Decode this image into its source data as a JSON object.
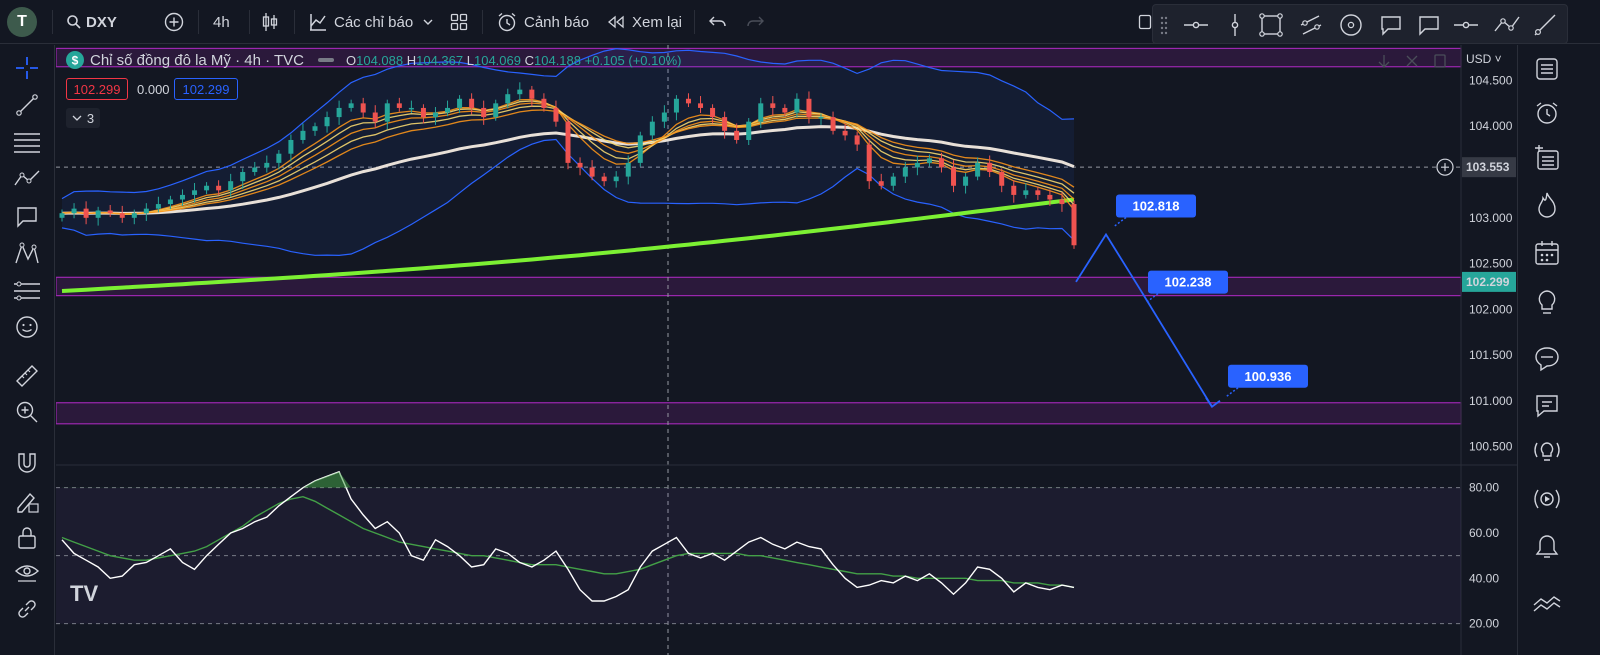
{
  "toolbar": {
    "avatar_letter": "T",
    "symbol": "DXY",
    "interval": "4h",
    "indicators_label": "Các chỉ báo",
    "alerts_label": "Cảnh báo",
    "replay_label": "Xem lại"
  },
  "legend": {
    "title": "Chỉ số đồng đô la Mỹ · 4h · TVC",
    "open_label": "O",
    "open": "104.088",
    "high_label": "H",
    "high": "104.367",
    "low_label": "L",
    "low": "104.069",
    "close_label": "C",
    "close": "104.188",
    "change": "+0.105 (+0.10%)",
    "bid": "102.299",
    "spread": "0.000",
    "ask": "102.299",
    "hidden_count": "3"
  },
  "price_axis": {
    "currency": "USD",
    "ticks": [
      "104.500",
      "104.000",
      "103.500",
      "103.000",
      "102.500",
      "102.000",
      "101.500",
      "101.000",
      "100.500"
    ],
    "crosshair_price": "103.553",
    "last_price": "102.299"
  },
  "rsi_axis": {
    "ticks": [
      "80.00",
      "60.00",
      "40.00",
      "20.00"
    ]
  },
  "annotations": [
    "102.818",
    "102.238",
    "100.936"
  ],
  "watermark": "TV",
  "colors": {
    "background": "#131722",
    "up": "#26a69a",
    "down": "#ef5350",
    "bollinger": "#2962ff",
    "ema_fast": "#f7931a",
    "ema_slow": "#f5d76e",
    "sma_white": "#e8e0d8",
    "sma_green": "#7cf033",
    "zone": "#9c27b0",
    "rsi": "#ffffff",
    "rsi_ma": "#43a047",
    "annotation": "#2962ff"
  },
  "icons": {
    "left": [
      "crosshair-icon",
      "trendline-icon",
      "fib-icon",
      "pattern-icon",
      "text-icon",
      "xabcd-icon",
      "forecast-icon",
      "emoji-icon",
      "ruler-icon",
      "zoom-icon",
      "magnet-icon",
      "lock-drawing-icon",
      "lock-icon",
      "eye-icon",
      "link-icon"
    ],
    "right": [
      "watchlist-icon",
      "alarm-icon",
      "data-window-icon",
      "hotlist-icon",
      "calendar-icon",
      "ideas-icon",
      "chat-icon",
      "messages-icon",
      "signals-icon",
      "streams-icon",
      "notifications-icon",
      "layers-icon"
    ],
    "drawing": [
      "drag-handle-icon",
      "horizontal-line-icon",
      "vertical-line-icon",
      "rectangle-icon",
      "parallel-channel-icon",
      "circle-icon",
      "callout-icon",
      "comment-icon",
      "price-line-icon",
      "path-icon",
      "ray-icon"
    ]
  },
  "chart_data": [
    {
      "type": "candlestick",
      "title": "Chỉ số đồng đô la Mỹ · 4h · TVC",
      "y_range": [
        100.3,
        104.8
      ],
      "n_bars": 85,
      "zones": [
        [
          104.65,
          104.85
        ],
        [
          102.15,
          102.35
        ],
        [
          100.75,
          100.98
        ]
      ],
      "closes": [
        103.05,
        103.1,
        103.0,
        103.08,
        103.05,
        103.0,
        103.05,
        103.1,
        103.15,
        103.2,
        103.25,
        103.3,
        103.35,
        103.3,
        103.4,
        103.5,
        103.55,
        103.6,
        103.7,
        103.85,
        103.95,
        104.0,
        104.1,
        104.2,
        104.25,
        104.15,
        104.05,
        104.25,
        104.2,
        104.2,
        104.1,
        104.15,
        104.2,
        104.3,
        104.2,
        104.1,
        104.25,
        104.35,
        104.4,
        104.3,
        104.2,
        104.05,
        103.6,
        103.55,
        103.45,
        103.4,
        103.45,
        103.6,
        103.9,
        104.05,
        104.15,
        104.3,
        104.25,
        104.2,
        104.1,
        103.95,
        103.85,
        104.05,
        104.25,
        104.2,
        104.15,
        104.3,
        104.1,
        104.1,
        103.95,
        103.9,
        103.8,
        103.4,
        103.35,
        103.45,
        103.55,
        103.6,
        103.65,
        103.55,
        103.35,
        103.45,
        103.6,
        103.5,
        103.35,
        103.25,
        103.3,
        103.25,
        103.2,
        103.15,
        102.7
      ],
      "bollinger": {
        "upper_start": 103.4,
        "lower_start": 102.5
      },
      "series": [
        {
          "name": "",
          "kind": "ema_ribbon"
        },
        {
          "name": "",
          "kind": "sma_white"
        },
        {
          "name": "",
          "kind": "sma_green",
          "values": [
            102.2,
            103.2
          ]
        }
      ],
      "projection": [
        [
          102.3,
          102.818
        ],
        [
          102.238,
          100.936
        ]
      ]
    },
    {
      "type": "line",
      "y_range": [
        15,
        90
      ],
      "levels": [
        80,
        50,
        20
      ],
      "rsi": [
        57,
        51,
        48,
        45,
        40,
        41,
        46,
        47,
        50,
        53,
        47,
        44,
        50,
        55,
        60,
        62,
        65,
        67,
        72,
        76,
        80,
        83,
        85,
        87,
        75,
        68,
        62,
        65,
        60,
        50,
        48,
        57,
        54,
        50,
        45,
        46,
        53,
        51,
        47,
        45,
        48,
        52,
        44,
        35,
        30,
        30,
        32,
        35,
        45,
        52,
        55,
        58,
        51,
        49,
        51,
        48,
        52,
        56,
        58,
        55,
        53,
        56,
        54,
        53,
        46,
        40,
        36,
        37,
        39,
        38,
        41,
        39,
        42,
        38,
        33,
        38,
        45,
        44,
        40,
        34,
        38,
        36,
        35,
        37,
        36
      ],
      "rsi_ma": [
        58,
        56,
        54,
        52,
        50,
        49,
        48,
        48,
        49,
        50,
        51,
        52,
        54,
        57,
        60,
        63,
        67,
        70,
        73,
        75,
        76,
        74,
        71,
        68,
        65,
        62,
        60,
        58,
        56,
        55,
        54,
        53,
        52,
        51,
        50,
        50,
        49,
        48,
        47,
        46,
        46,
        46,
        45,
        44,
        43,
        42,
        42,
        43,
        44,
        46,
        48,
        50,
        51,
        51,
        51,
        51,
        51,
        50,
        50,
        49,
        48,
        47,
        46,
        45,
        44,
        43,
        42,
        42,
        42,
        41,
        41,
        40,
        40,
        40,
        40,
        40,
        39,
        39,
        39,
        38,
        38,
        38,
        37,
        37,
        36
      ]
    }
  ]
}
